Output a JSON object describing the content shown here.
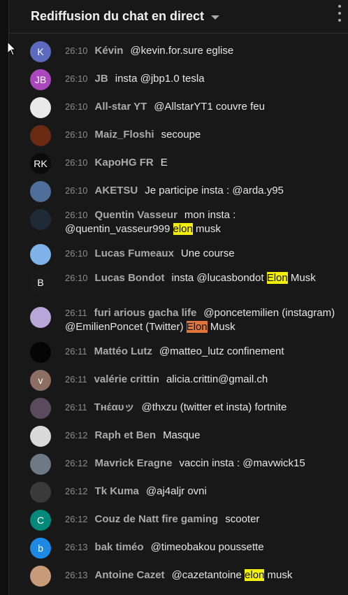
{
  "header": {
    "title": "Rediffusion du chat en direct",
    "menu_icon": "more-vertical-icon",
    "dropdown_icon": "caret-down-icon"
  },
  "colors": {
    "background": "#181818",
    "author": "#aaaaaa",
    "timestamp": "#8c8c8c",
    "highlight_yellow": "#f3ee0c",
    "highlight_orange": "#e2753b"
  },
  "messages": [
    {
      "time": "26:10",
      "author": "Kévin",
      "avatar": {
        "letter": "K",
        "color": "#5c6bc0"
      },
      "text": "@kevin.for.sure eglise"
    },
    {
      "time": "26:10",
      "author": "JB",
      "avatar": {
        "letter": "JB",
        "color": "#ab47bc"
      },
      "text": "insta @jbp1.0 tesla"
    },
    {
      "time": "26:10",
      "author": "All-star YT",
      "avatar": {
        "letter": "",
        "color": "#e9e9e9"
      },
      "text": "@AllstarYT1 couvre feu"
    },
    {
      "time": "26:10",
      "author": "Maiz_Floshi",
      "avatar": {
        "letter": "",
        "color": "#6b2a12"
      },
      "text": "secoupe"
    },
    {
      "time": "26:10",
      "author": "KapoHG FR",
      "avatar": {
        "letter": "RK",
        "color": "#0a0a0a"
      },
      "text": "E"
    },
    {
      "time": "26:10",
      "author": "AKETSU",
      "avatar": {
        "letter": "",
        "color": "#4f6f9a"
      },
      "text": "Je participe insta : @arda.y95"
    },
    {
      "time": "26:10",
      "author": "Quentin Vasseur",
      "avatar": {
        "letter": "",
        "color": "#1e2a36"
      },
      "text_before": "mon insta : @quentin_vasseur999",
      "highlight": "elon",
      "text_after": "musk"
    },
    {
      "time": "26:10",
      "author": "Lucas Fumeaux",
      "avatar": {
        "letter": "",
        "color": "#7fb2e8"
      },
      "text": "Une course"
    },
    {
      "time": "26:10",
      "author": "Lucas Bondot",
      "avatar": {
        "letter": "B",
        "color": "#1a1a1a"
      },
      "text_before": "insta @lucasbondot",
      "highlight": "Elon",
      "text_after": "Musk"
    },
    {
      "time": "26:11",
      "author": "furi arious gacha life",
      "avatar": {
        "letter": "",
        "color": "#b9a6d8"
      },
      "text_before": "@poncetemilien (instagram) @EmilienPoncet (Twitter)",
      "highlight": "Elon",
      "text_after": "Musk"
    },
    {
      "time": "26:11",
      "author": "Mattéo Lutz",
      "avatar": {
        "letter": "",
        "color": "#050505"
      },
      "text": "@matteo_lutz confinement"
    },
    {
      "time": "26:11",
      "author": "valérie crittin",
      "avatar": {
        "letter": "v",
        "color": "#8d6e63"
      },
      "text": "alicia.crittin@gmail.ch"
    },
    {
      "time": "26:11",
      "author": "Tнέαυッ",
      "avatar": {
        "letter": "",
        "color": "#5a4a5e"
      },
      "text": "@thxzu (twitter et insta) fortnite"
    },
    {
      "time": "26:12",
      "author": "Raph et Ben",
      "avatar": {
        "letter": "",
        "color": "#d9d9d9"
      },
      "text": "Masque"
    },
    {
      "time": "26:12",
      "author": "Mavrick Eragne",
      "avatar": {
        "letter": "",
        "color": "#6d7a86"
      },
      "text": "vaccin insta : @mavwick15"
    },
    {
      "time": "26:12",
      "author": "Tk Kuma",
      "avatar": {
        "letter": "",
        "color": "#3a3a3a"
      },
      "text": "@aj4aljr ovni"
    },
    {
      "time": "26:12",
      "author": "Couz de Natt fire gaming",
      "avatar": {
        "letter": "C",
        "color": "#00897b"
      },
      "text": "scooter"
    },
    {
      "time": "26:13",
      "author": "bak timéo",
      "avatar": {
        "letter": "b",
        "color": "#1e88e5"
      },
      "text": "@timeobakou poussette"
    },
    {
      "time": "26:13",
      "author": "Antoine Cazet",
      "avatar": {
        "letter": "",
        "color": "#c89a7a"
      },
      "text_before": "@cazetantoine",
      "highlight": "elon",
      "text_after": "musk"
    }
  ]
}
